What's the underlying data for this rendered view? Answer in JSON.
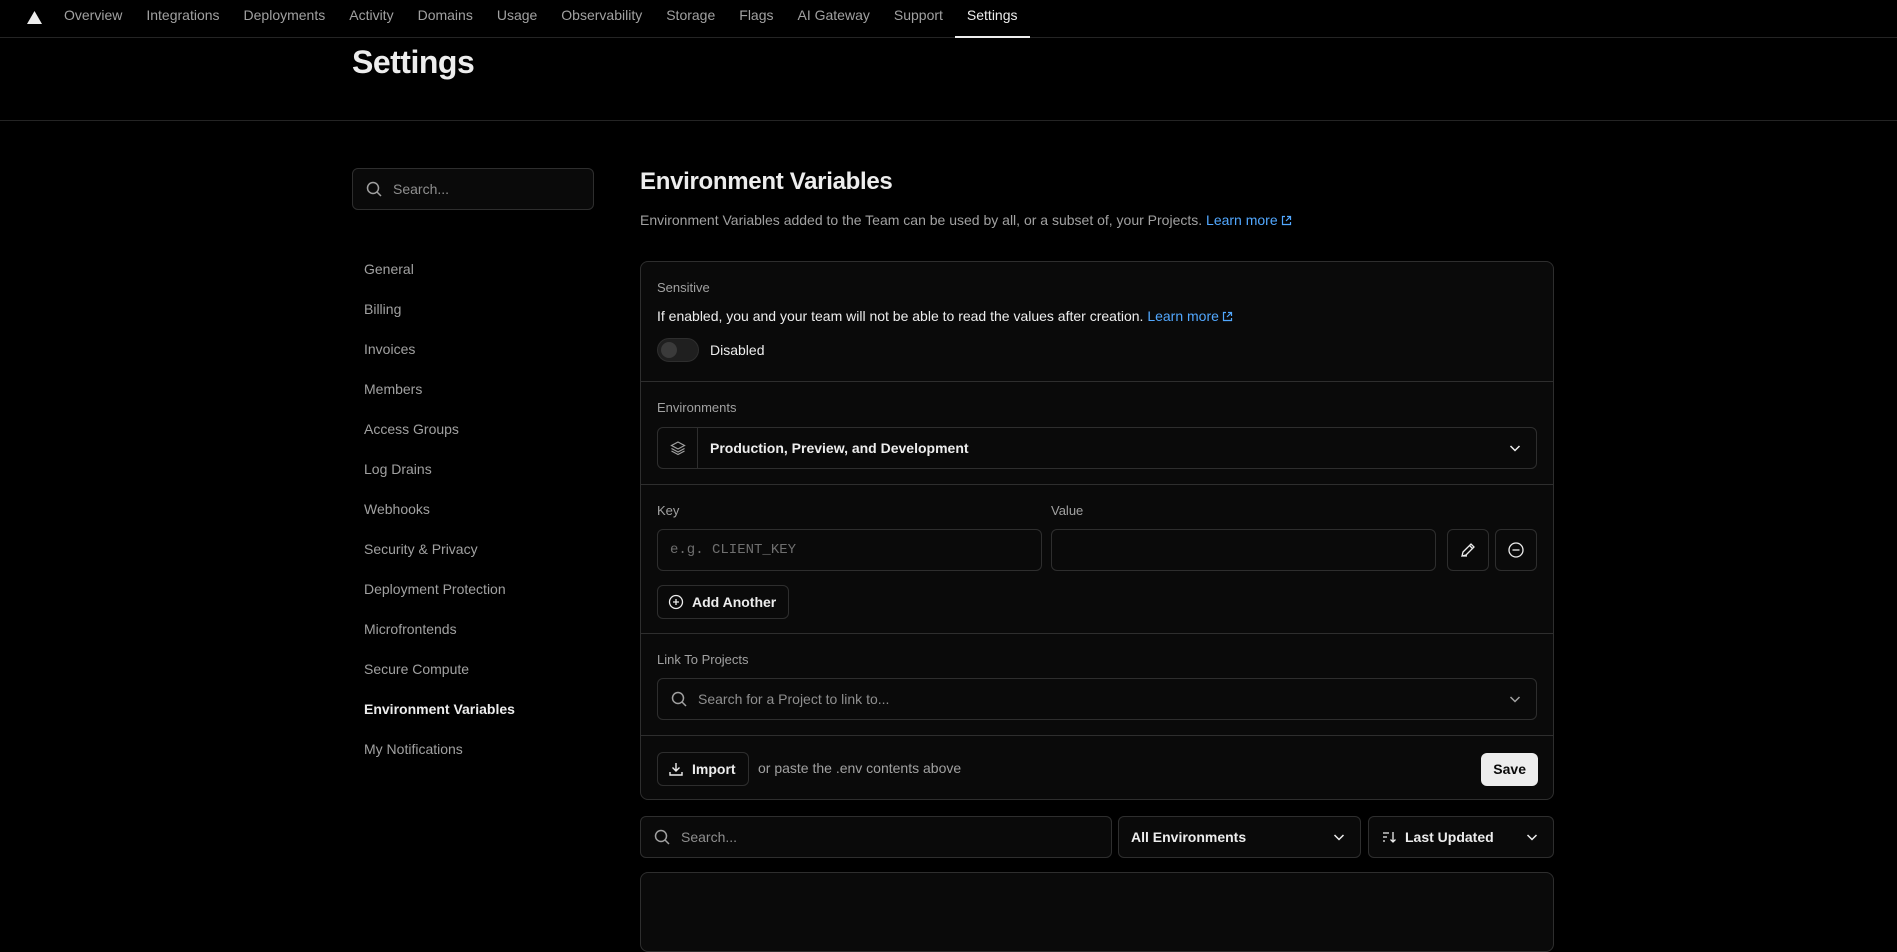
{
  "nav": {
    "tabs": [
      "Overview",
      "Integrations",
      "Deployments",
      "Activity",
      "Domains",
      "Usage",
      "Observability",
      "Storage",
      "Flags",
      "AI Gateway",
      "Support",
      "Settings"
    ],
    "active_tab": "Settings"
  },
  "page": {
    "title": "Settings"
  },
  "sidebar": {
    "search_placeholder": "Search...",
    "items": [
      "General",
      "Billing",
      "Invoices",
      "Members",
      "Access Groups",
      "Log Drains",
      "Webhooks",
      "Security & Privacy",
      "Deployment Protection",
      "Microfrontends",
      "Secure Compute",
      "Environment Variables",
      "My Notifications"
    ],
    "active_item": "Environment Variables"
  },
  "section": {
    "title": "Environment Variables",
    "description": "Environment Variables added to the Team can be used by all, or a subset of, your Projects.",
    "learn_more": "Learn more"
  },
  "sensitive": {
    "label": "Sensitive",
    "description": "If enabled, you and your team will not be able to read the values after creation.",
    "learn_more": "Learn more",
    "toggle_state": "Disabled"
  },
  "environments": {
    "label": "Environments",
    "selected": "Production, Preview, and Development"
  },
  "kv": {
    "key_label": "Key",
    "value_label": "Value",
    "key_placeholder": "e.g. CLIENT_KEY",
    "value_placeholder": "",
    "add_another": "Add Another"
  },
  "link_projects": {
    "label": "Link To Projects",
    "placeholder": "Search for a Project to link to..."
  },
  "footer": {
    "import_label": "Import",
    "paste_hint": "or paste the .env contents above",
    "save_label": "Save"
  },
  "filters": {
    "search_placeholder": "Search...",
    "environment": "All Environments",
    "sort": "Last Updated"
  },
  "colors": {
    "accent_link": "#52a8ff",
    "background": "#000000",
    "card": "#0a0a0a",
    "border": "#2e2e2e"
  }
}
